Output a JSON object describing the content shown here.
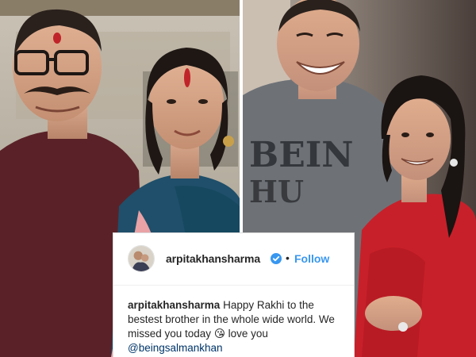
{
  "post": {
    "username": "arpitakhansharma",
    "verified_icon": "verified-badge-icon",
    "separator": "•",
    "follow_label": "Follow",
    "caption": {
      "author": "arpitakhansharma",
      "text": " Happy Rakhi to the bestest brother in the whole wide world. We missed you today ",
      "emoji": "😘",
      "text_after": "  love you ",
      "mention": "@beingsalmankhan"
    }
  },
  "colors": {
    "link_blue": "#3897f0",
    "verified_blue": "#3897f0",
    "text_dark": "#262626",
    "mention": "#003569"
  }
}
